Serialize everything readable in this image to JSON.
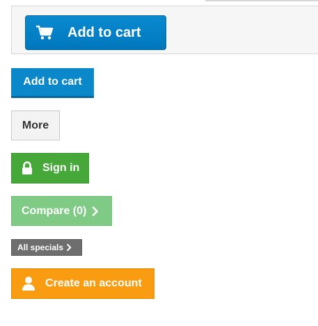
{
  "panel": {
    "add_to_cart_label": "Add to cart"
  },
  "buttons": {
    "add_to_cart": "Add to cart",
    "more": "More",
    "sign_in": "Sign in",
    "compare": "Compare (0)",
    "all_specials": "All specials",
    "create_account": "Create an account"
  },
  "icons": {
    "cart": "cart-icon",
    "lock": "lock-icon",
    "chevron": "chevron-right-icon",
    "user": "user-icon"
  },
  "colors": {
    "primary_blue": "#0a88c9",
    "success_green": "#45a838",
    "compare_green": "#7fcb86",
    "neutral_gray": "#6e6e6e",
    "warning_orange": "#f99c12"
  }
}
